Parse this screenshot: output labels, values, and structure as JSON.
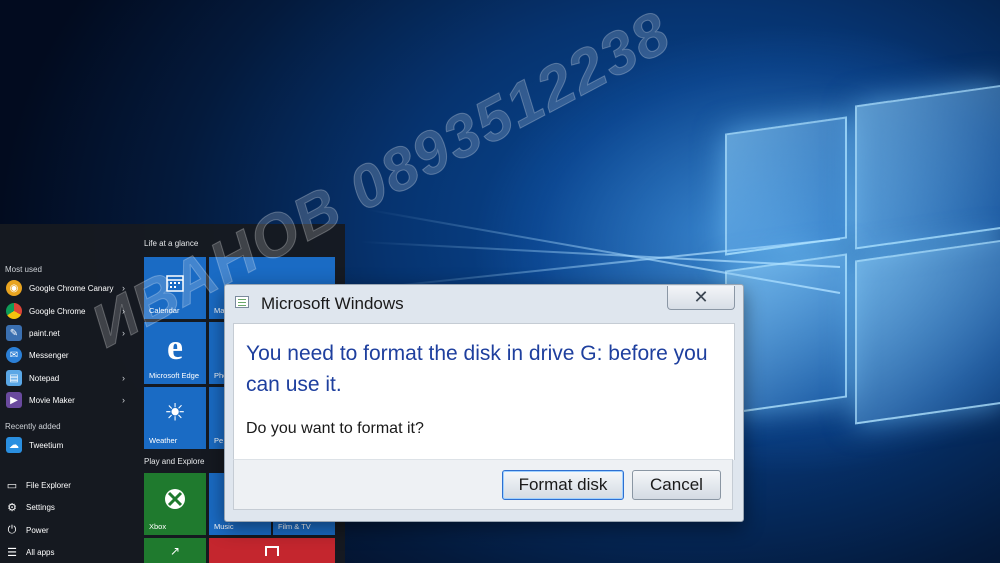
{
  "start_menu": {
    "most_used_label": "Most used",
    "most_used": [
      {
        "label": "Google Chrome Canary",
        "icon": "chrome-canary-icon",
        "has_arrow": true
      },
      {
        "label": "Google Chrome",
        "icon": "chrome-icon",
        "has_arrow": true
      },
      {
        "label": "paint.net",
        "icon": "paintnet-icon",
        "has_arrow": true
      },
      {
        "label": "Messenger",
        "icon": "messenger-icon",
        "has_arrow": false
      },
      {
        "label": "Notepad",
        "icon": "notepad-icon",
        "has_arrow": true
      },
      {
        "label": "Movie Maker",
        "icon": "movie-maker-icon",
        "has_arrow": true
      }
    ],
    "recently_added_label": "Recently added",
    "recently_added": [
      {
        "label": "Tweetium",
        "icon": "tweetium-icon"
      }
    ],
    "system": [
      {
        "label": "File Explorer",
        "icon": "folder-icon"
      },
      {
        "label": "Settings",
        "icon": "gear-icon"
      },
      {
        "label": "Power",
        "icon": "power-icon"
      },
      {
        "label": "All apps",
        "icon": "all-apps-icon"
      }
    ],
    "groups": {
      "life_at_a_glance": "Life at a glance",
      "play_and_explore": "Play and Explore"
    },
    "tiles": {
      "calendar": "Calendar",
      "mail": "Ma",
      "edge": "Microsoft Edge",
      "photos": "Pho",
      "weather": "Weather",
      "people": "Pe",
      "xbox": "Xbox",
      "music": "Music",
      "film": "Film & TV"
    }
  },
  "dialog": {
    "title": "Microsoft Windows",
    "main_instruction": "You need to format the disk in drive G: before you can use it.",
    "question": "Do you want to format it?",
    "buttons": {
      "primary": "Format disk",
      "cancel": "Cancel"
    }
  },
  "watermark": "ИВАНОВ 0893512238",
  "colors": {
    "tile_blue": "#1565c0",
    "tile_green": "#1f7a2e",
    "tile_red": "#c4262e",
    "instruction_blue": "#1e3f9e"
  }
}
